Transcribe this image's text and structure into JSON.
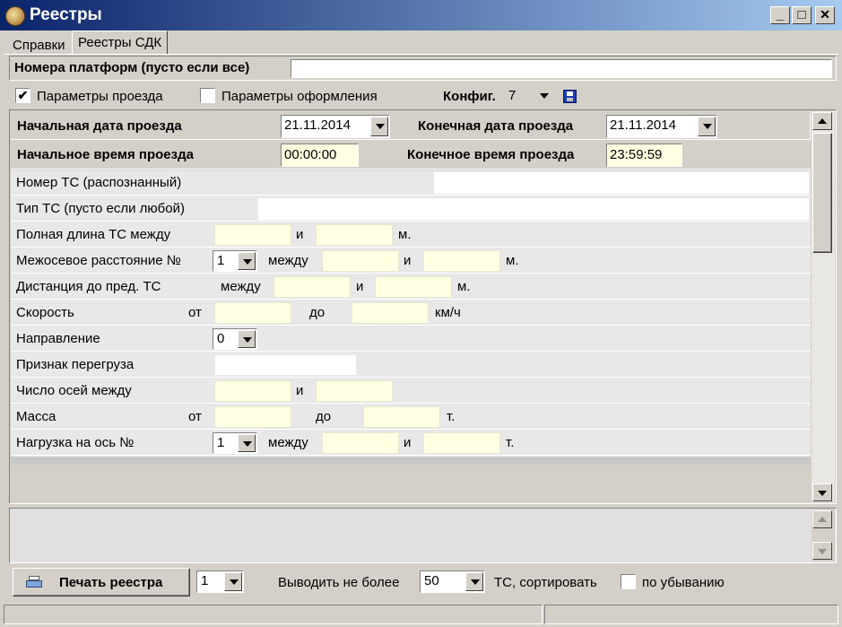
{
  "window": {
    "title": "Реестры",
    "minimize": "_",
    "maximize": "□",
    "close": "✕"
  },
  "tabs": [
    {
      "label": "Справки"
    },
    {
      "label": "Реестры СДК"
    }
  ],
  "platforms": {
    "label": "Номера платформ (пусто если все)",
    "value": ""
  },
  "options": {
    "trip_params": {
      "label": "Параметры проезда",
      "checked": true
    },
    "design_params": {
      "label": "Параметры оформления",
      "checked": false
    },
    "config_label": "Конфиг.",
    "config_value": "7"
  },
  "filters": {
    "start_date": {
      "label": "Начальная дата проезда",
      "value": "21.11.2014"
    },
    "end_date": {
      "label": "Конечная дата проезда",
      "value": "21.11.2014"
    },
    "start_time": {
      "label": "Начальное время проезда",
      "value": "00:00:00"
    },
    "end_time": {
      "label": "Конечное время проезда",
      "value": "23:59:59"
    },
    "plate": {
      "label": "Номер ТС  (распознанный)",
      "value": ""
    },
    "type": {
      "label": "Тип ТС (пусто если любой)",
      "value": ""
    },
    "length": {
      "label": "Полная длина ТС между",
      "and": "и",
      "unit": "м."
    },
    "axle_dist": {
      "label": "Межосевое расстояние №",
      "select": "1",
      "between": "между",
      "and": "и",
      "unit": "м."
    },
    "gap": {
      "label": "Дистанция до пред. ТС",
      "between": "между",
      "and": "и",
      "unit": "м."
    },
    "speed": {
      "label": "Скорость",
      "from": "от",
      "to": "до",
      "unit": "км/ч"
    },
    "direction": {
      "label": "Направление",
      "select": "0"
    },
    "overload": {
      "label": "Признак перегруза",
      "value": ""
    },
    "axles": {
      "label": "Число осей между",
      "and": "и"
    },
    "mass": {
      "label": "Масса",
      "from": "от",
      "to": "до",
      "unit": "т."
    },
    "axle_load": {
      "label": "Нагрузка на ось  №",
      "select": "1",
      "between": "между",
      "and": "и",
      "unit": "т."
    }
  },
  "footer": {
    "print_label": "Печать реестра",
    "copies": "1",
    "limit_label": "Выводить не более",
    "limit_value": "50",
    "ts_sort": "ТС,  сортировать",
    "descending_label": "по убыванию",
    "descending": false
  },
  "colors": {
    "titlebar": "#0a246a",
    "field_highlight": "#ffffe1"
  },
  "icons": {
    "app": "app-icon",
    "save": "floppy-disk-icon",
    "printer": "printer-icon"
  }
}
